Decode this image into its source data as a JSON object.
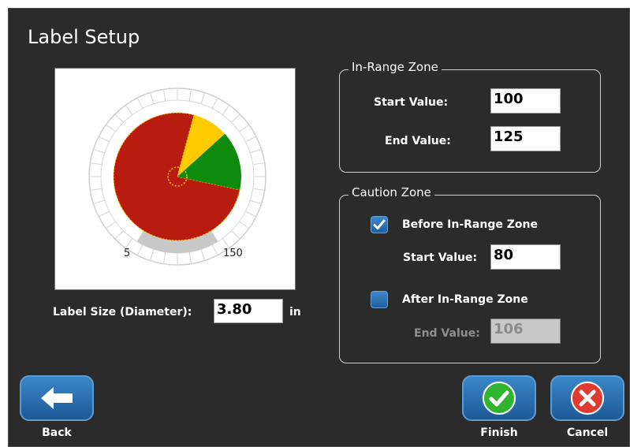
{
  "title": "Label Setup",
  "preview": {
    "tick_min": "5",
    "tick_max": "150",
    "colors": {
      "caution": "#ffcc00",
      "in_range": "#0e8a0e",
      "out_of_range": "#b81b10",
      "dead_zone": "#c8c8c8"
    }
  },
  "label_size": {
    "label": "Label Size (Diameter):",
    "value": "3.80",
    "unit": "in"
  },
  "in_range_zone": {
    "legend": "In-Range Zone",
    "start_label": "Start Value:",
    "start_value": "100",
    "end_label": "End Value:",
    "end_value": "125"
  },
  "caution_zone": {
    "legend": "Caution Zone",
    "before": {
      "label": "Before In-Range Zone",
      "checked": true,
      "start_label": "Start Value:",
      "start_value": "80"
    },
    "after": {
      "label": "After In-Range Zone",
      "checked": false,
      "end_label": "End Value:",
      "end_value": "106"
    }
  },
  "buttons": {
    "back": "Back",
    "finish": "Finish",
    "cancel": "Cancel"
  },
  "icons": {
    "back": "arrow-left-icon",
    "finish": "checkmark-icon",
    "cancel": "x-icon",
    "checkbox": "check-icon"
  }
}
